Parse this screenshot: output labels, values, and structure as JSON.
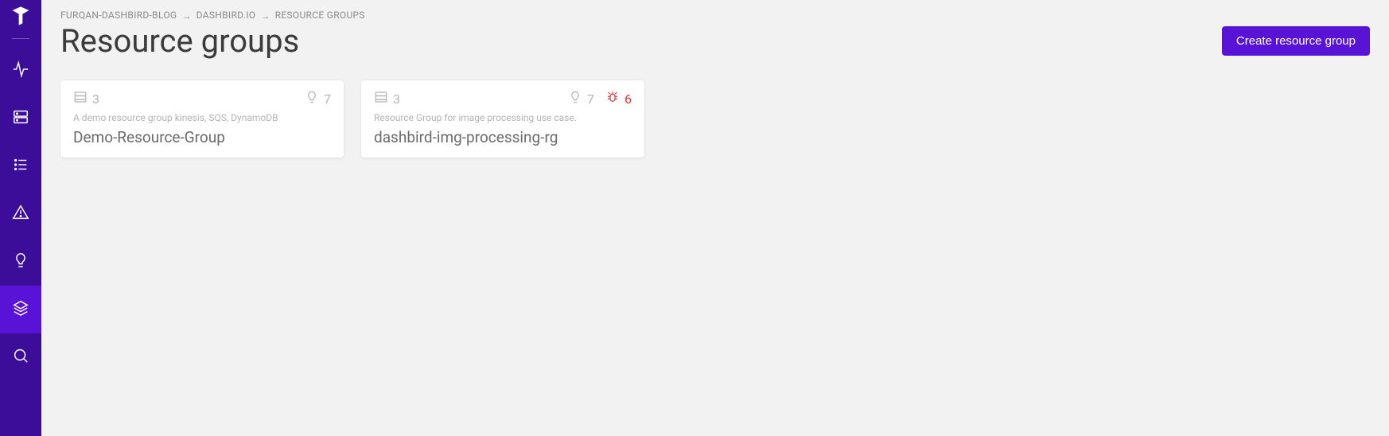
{
  "sidebar": {
    "items": [
      {
        "name": "monitoring",
        "icon": "activity-icon"
      },
      {
        "name": "inventory",
        "icon": "server-icon"
      },
      {
        "name": "logs",
        "icon": "list-icon"
      },
      {
        "name": "alerts",
        "icon": "alert-triangle-icon"
      },
      {
        "name": "insights",
        "icon": "lightbulb-icon"
      },
      {
        "name": "resource-groups",
        "icon": "layers-icon",
        "active": true
      },
      {
        "name": "search",
        "icon": "search-icon"
      }
    ]
  },
  "breadcrumbs": [
    "FURQAN-DASHBIRD-BLOG",
    "DASHBIRD.IO",
    "RESOURCE GROUPS"
  ],
  "header": {
    "title": "Resource groups",
    "create_button": "Create resource group"
  },
  "cards": [
    {
      "resources": "3",
      "insights": "7",
      "errors": "",
      "description": "A demo resource group kinesis, SQS, DynamoDB",
      "name": "Demo-Resource-Group"
    },
    {
      "resources": "3",
      "insights": "7",
      "errors": "6",
      "description": "Resource Group for image processing use case.",
      "name": "dashbird-img-processing-rg"
    }
  ]
}
